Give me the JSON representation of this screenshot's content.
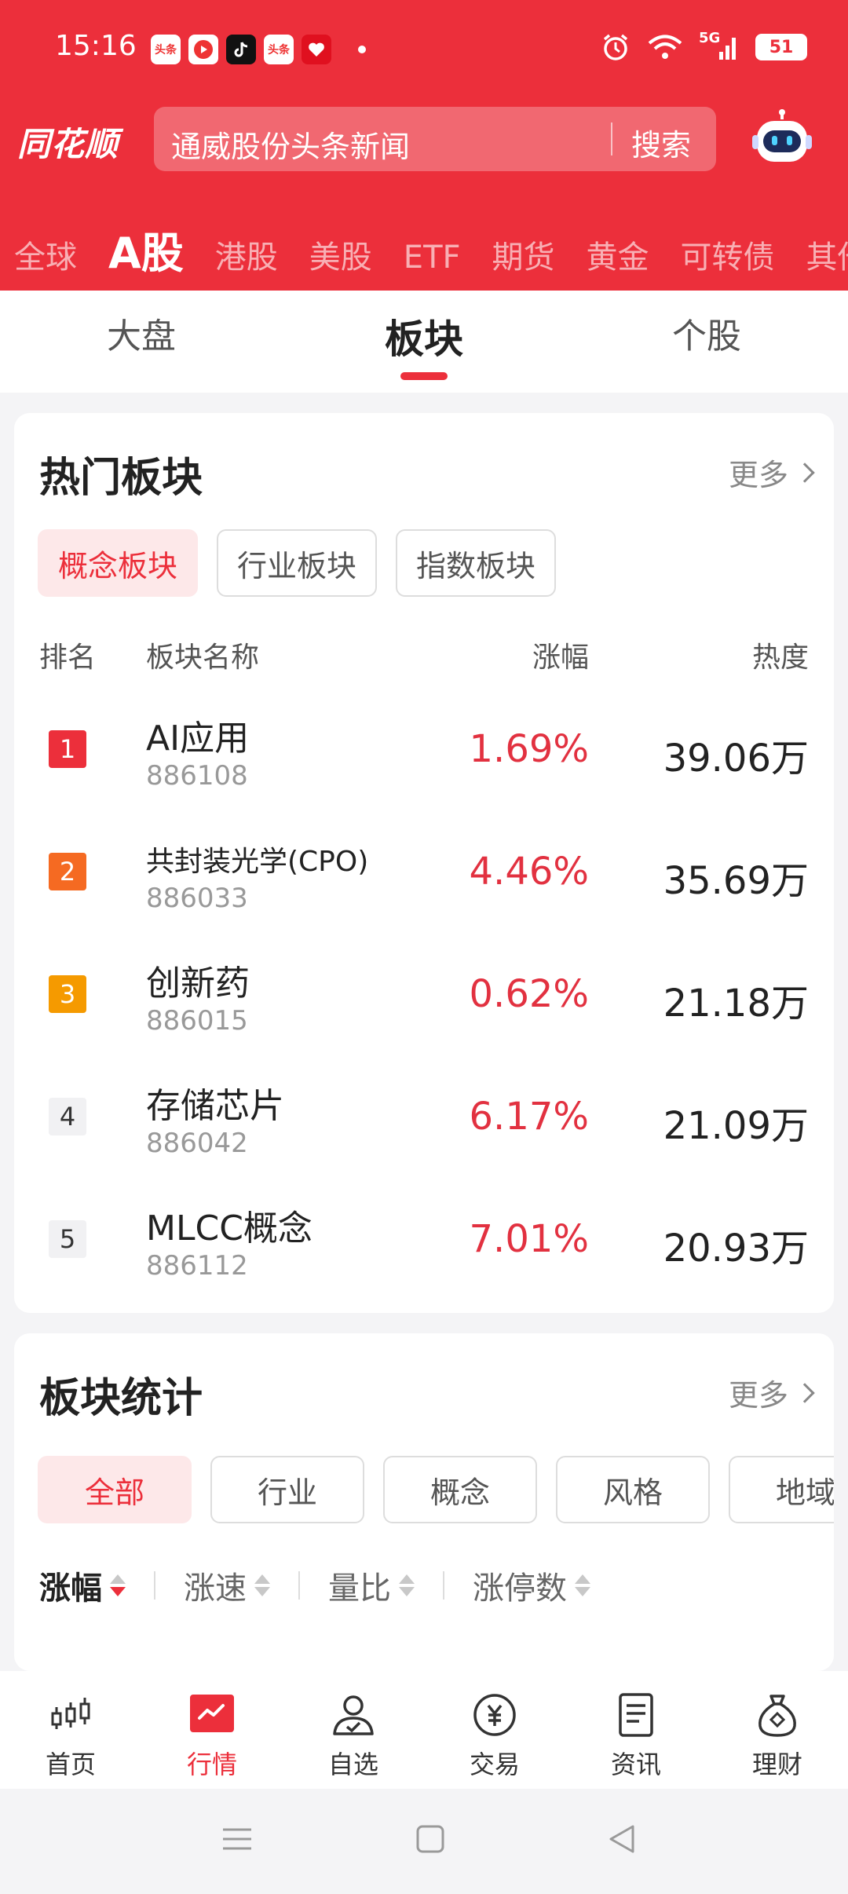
{
  "status": {
    "time": "15:16",
    "battery": "51",
    "network": "5G",
    "apps": [
      "头条",
      "头条"
    ]
  },
  "header": {
    "logo": "同花顺",
    "search_placeholder": "通威股份头条新闻",
    "search_button": "搜索"
  },
  "market_tabs": [
    {
      "label": "全球"
    },
    {
      "label": "A股"
    },
    {
      "label": "港股"
    },
    {
      "label": "美股"
    },
    {
      "label": "ETF"
    },
    {
      "label": "期货"
    },
    {
      "label": "黄金"
    },
    {
      "label": "可转债"
    },
    {
      "label": "其他"
    }
  ],
  "sub_tabs": [
    {
      "label": "大盘"
    },
    {
      "label": "板块"
    },
    {
      "label": "个股"
    }
  ],
  "hot_sectors": {
    "title": "热门板块",
    "more": "更多",
    "chips": [
      {
        "label": "概念板块"
      },
      {
        "label": "行业板块"
      },
      {
        "label": "指数板块"
      }
    ],
    "columns": {
      "rank": "排名",
      "name": "板块名称",
      "change": "涨幅",
      "heat": "热度"
    },
    "rows": [
      {
        "rank": "1",
        "name": "AI应用",
        "code": "886108",
        "change": "1.69%",
        "heat": "39.06万"
      },
      {
        "rank": "2",
        "name": "共封装光学(CPO)",
        "code": "886033",
        "change": "4.46%",
        "heat": "35.69万"
      },
      {
        "rank": "3",
        "name": "创新药",
        "code": "886015",
        "change": "0.62%",
        "heat": "21.18万"
      },
      {
        "rank": "4",
        "name": "存储芯片",
        "code": "886042",
        "change": "6.17%",
        "heat": "21.09万"
      },
      {
        "rank": "5",
        "name": "MLCC概念",
        "code": "886112",
        "change": "7.01%",
        "heat": "20.93万"
      }
    ]
  },
  "sector_stats": {
    "title": "板块统计",
    "more": "更多",
    "chips": [
      {
        "label": "全部"
      },
      {
        "label": "行业"
      },
      {
        "label": "概念"
      },
      {
        "label": "风格"
      },
      {
        "label": "地域"
      }
    ],
    "sorts": [
      {
        "label": "涨幅"
      },
      {
        "label": "涨速"
      },
      {
        "label": "量比"
      },
      {
        "label": "涨停数"
      }
    ]
  },
  "bottom_nav": [
    {
      "label": "首页",
      "icon": "candlestick-icon"
    },
    {
      "label": "行情",
      "icon": "chart-icon"
    },
    {
      "label": "自选",
      "icon": "user-check-icon"
    },
    {
      "label": "交易",
      "icon": "yuan-icon"
    },
    {
      "label": "资讯",
      "icon": "document-icon"
    },
    {
      "label": "理财",
      "icon": "moneybag-icon"
    }
  ],
  "colors": {
    "brand": "#ec2f3b",
    "up": "#e23140"
  }
}
